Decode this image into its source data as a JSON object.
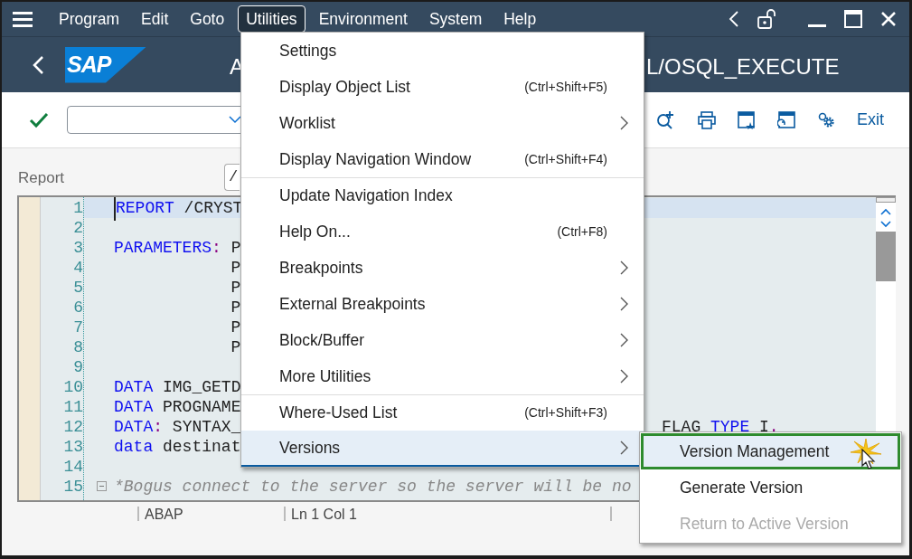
{
  "menu_bar": [
    {
      "label": "Program",
      "selected": false
    },
    {
      "label": "Edit",
      "selected": false
    },
    {
      "label": "Goto",
      "selected": false
    },
    {
      "label": "Utilities",
      "selected": true
    },
    {
      "label": "Environment",
      "selected": false
    },
    {
      "label": "System",
      "selected": false
    },
    {
      "label": "Help",
      "selected": false
    }
  ],
  "header": {
    "logo": "SAP",
    "title_left": "A",
    "title_right": "L/OSQL_EXECUTE"
  },
  "toolbar": {
    "exit": "Exit"
  },
  "report": {
    "label": "Report",
    "value": "/"
  },
  "editor": {
    "lines": [
      {
        "number": "1",
        "current": true,
        "tokens": [
          {
            "kind": "keyword",
            "text": "REPORT"
          },
          {
            "kind": "text",
            "text": " /CRYST"
          }
        ]
      },
      {
        "number": "2",
        "current": false
      },
      {
        "number": "3",
        "current": false,
        "tokens": [
          {
            "kind": "keyword",
            "text": "PARAMETERS"
          },
          {
            "kind": "punct",
            "text": ":"
          },
          {
            "kind": "text",
            "text": " P"
          }
        ]
      },
      {
        "number": "4",
        "current": false,
        "tokens": [
          {
            "kind": "text",
            "text": "            P"
          }
        ]
      },
      {
        "number": "5",
        "current": false,
        "tokens": [
          {
            "kind": "text",
            "text": "            P"
          }
        ]
      },
      {
        "number": "6",
        "current": false,
        "tokens": [
          {
            "kind": "text",
            "text": "            P"
          }
        ]
      },
      {
        "number": "7",
        "current": false,
        "tokens": [
          {
            "kind": "text",
            "text": "            P"
          }
        ]
      },
      {
        "number": "8",
        "current": false,
        "tokens": [
          {
            "kind": "text",
            "text": "            P"
          }
        ]
      },
      {
        "number": "9",
        "current": false
      },
      {
        "number": "10",
        "current": false,
        "tokens": [
          {
            "kind": "keyword",
            "text": "DATA"
          },
          {
            "kind": "text",
            "text": " IMG_GETD"
          }
        ]
      },
      {
        "number": "11",
        "current": false,
        "tokens": [
          {
            "kind": "keyword",
            "text": "DATA"
          },
          {
            "kind": "text",
            "text": " PROGNAME"
          }
        ]
      },
      {
        "number": "12",
        "current": false,
        "tokens": [
          {
            "kind": "keyword",
            "text": "DATA"
          },
          {
            "kind": "punct",
            "text": ":"
          },
          {
            "kind": "text",
            "text": " SYNTAX_"
          }
        ],
        "right_tokens": [
          {
            "kind": "text",
            "text": "FLAG"
          },
          {
            "kind": "keyword",
            "text": " TYPE"
          },
          {
            "kind": "text",
            "text": " I"
          },
          {
            "kind": "punct",
            "text": "."
          }
        ]
      },
      {
        "number": "13",
        "current": false,
        "tokens": [
          {
            "kind": "keyword",
            "text": "data"
          },
          {
            "kind": "text",
            "text": " destinat"
          }
        ]
      },
      {
        "number": "14",
        "current": false
      },
      {
        "number": "15",
        "current": false,
        "collapsible": true,
        "tokens": [
          {
            "kind": "comment",
            "text": "*Bogus connect to the server so the server will be no"
          }
        ]
      }
    ]
  },
  "status_bar": [
    "ABAP",
    "Ln  1 Col  1"
  ],
  "utilities_menu": [
    {
      "kind": "item",
      "label": "Settings",
      "selected": false
    },
    {
      "kind": "item",
      "label": "Display Object List",
      "shortcut": "(Ctrl+Shift+F5)",
      "selected": false
    },
    {
      "kind": "submenu",
      "label": "Worklist",
      "selected": false
    },
    {
      "kind": "item",
      "label": "Display Navigation Window",
      "shortcut": "(Ctrl+Shift+F4)",
      "selected": false
    },
    {
      "kind": "item",
      "label": "Update Navigation Index",
      "separator_before": true,
      "selected": false
    },
    {
      "kind": "item",
      "label": "Help On...",
      "shortcut": "(Ctrl+F8)",
      "selected": false
    },
    {
      "kind": "submenu",
      "label": "Breakpoints",
      "selected": false
    },
    {
      "kind": "submenu",
      "label": "External Breakpoints",
      "selected": false
    },
    {
      "kind": "submenu",
      "label": "Block/Buffer",
      "selected": false
    },
    {
      "kind": "submenu",
      "label": "More Utilities",
      "selected": false
    },
    {
      "kind": "item",
      "label": "Where-Used List",
      "shortcut": "(Ctrl+Shift+F3)",
      "separator_before": true,
      "selected": false
    },
    {
      "kind": "submenu",
      "label": "Versions",
      "selected": true
    }
  ],
  "versions_submenu": [
    {
      "label": "Version Management",
      "selected": true,
      "disabled": false
    },
    {
      "label": "Generate Version",
      "selected": false,
      "disabled": false
    },
    {
      "label": "Return to Active Version",
      "selected": false,
      "disabled": true
    }
  ]
}
